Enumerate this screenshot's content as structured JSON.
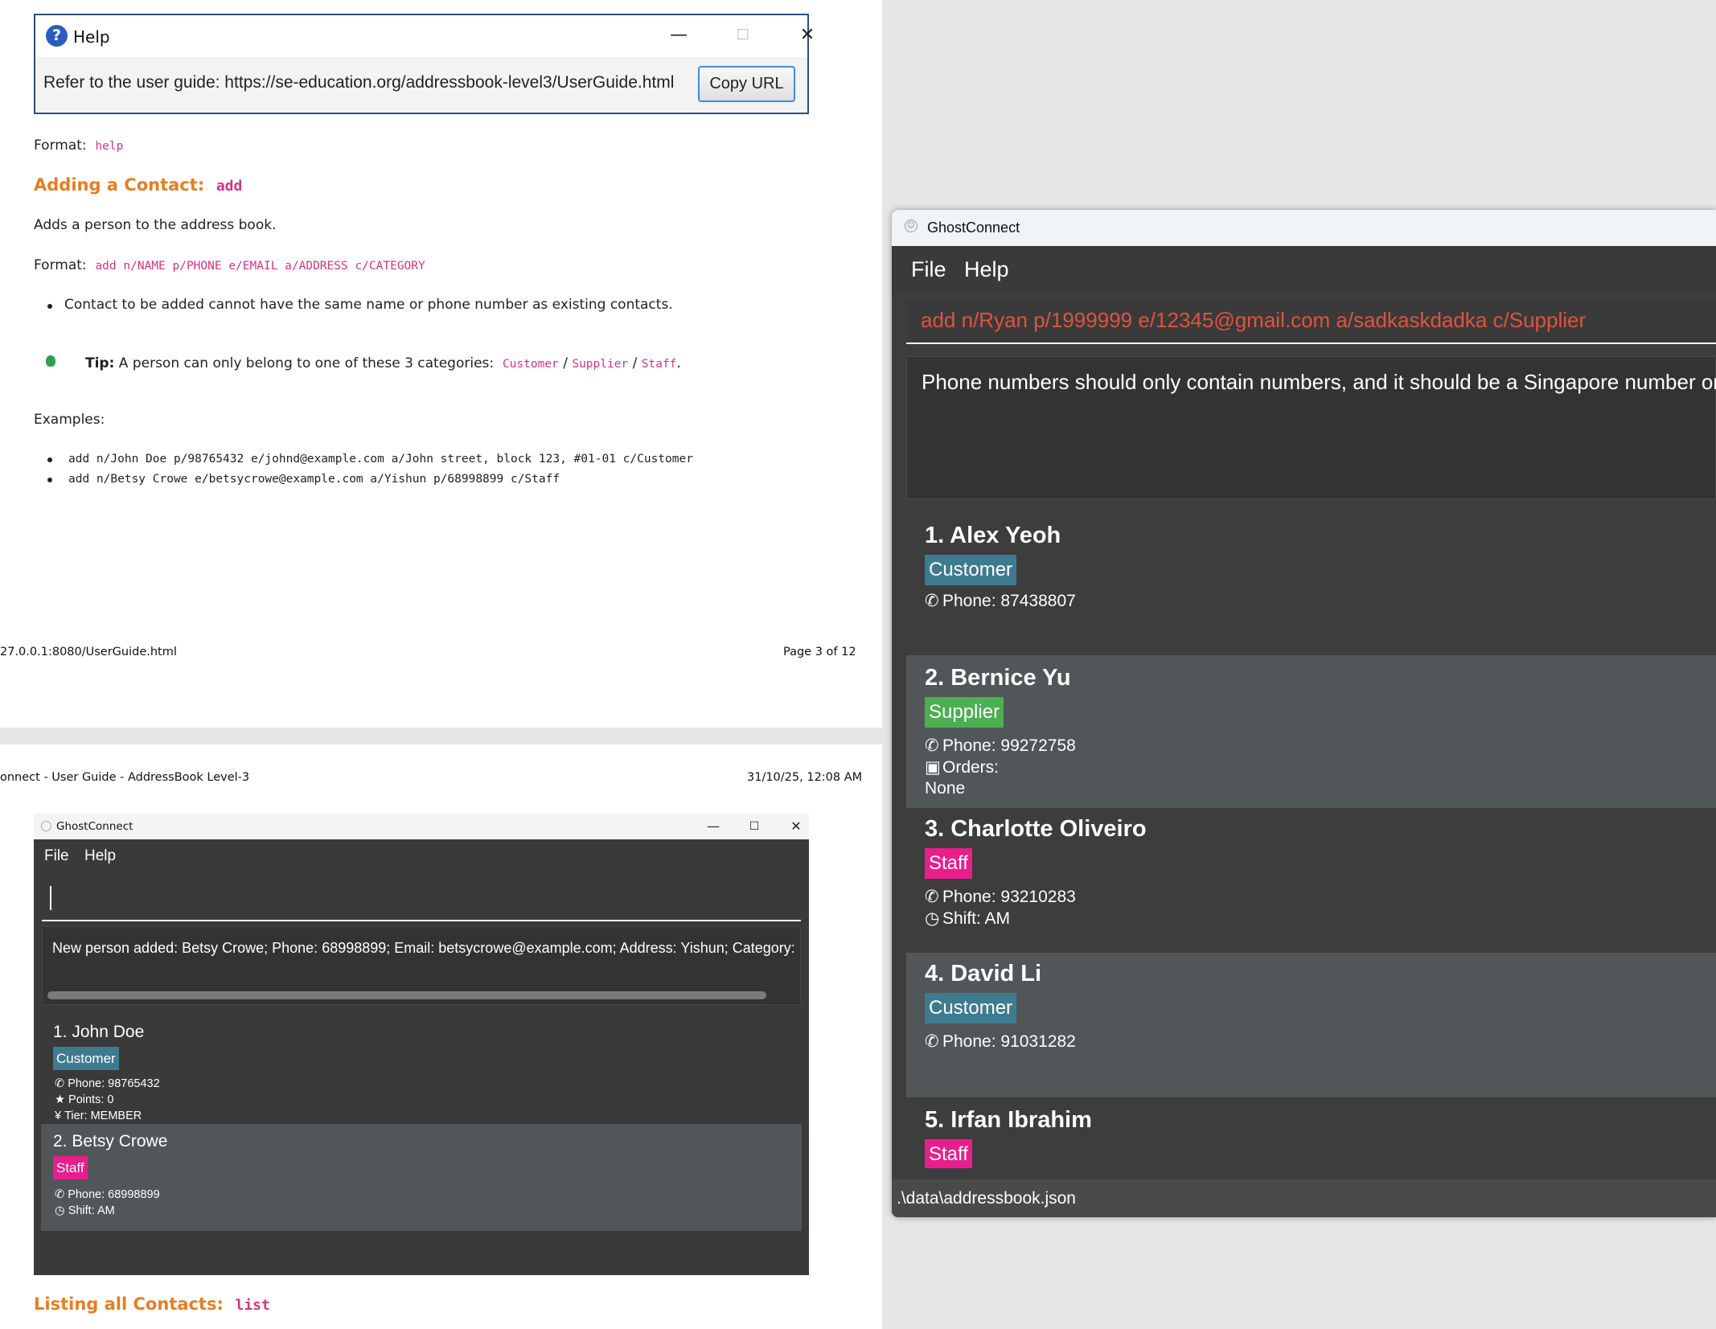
{
  "help_dialog": {
    "title": "Help",
    "icon": "question-icon",
    "message": "Refer to the user guide: https://se-education.org/addressbook-level3/UserGuide.html",
    "copy_button": "Copy URL"
  },
  "page1": {
    "help_format_label": "Format:",
    "help_format_code": "help",
    "add_heading": "Adding a Contact:",
    "add_heading_code": "add",
    "add_desc": "Adds a person to the address book.",
    "add_format_label": "Format:",
    "add_format_code": "add n/NAME p/PHONE e/EMAIL a/ADDRESS c/CATEGORY",
    "bullet_1": "Contact to be added cannot have the same name or phone number as existing contacts.",
    "tip_label": "Tip:",
    "tip_text": "A person can only belong to one of these 3 categories:",
    "tip_cat_1": "Customer",
    "tip_sep_1": "/",
    "tip_cat_2": "Supplier",
    "tip_sep_2": "/",
    "tip_cat_3": "Staff",
    "tip_end": ".",
    "examples_label": "Examples:",
    "example_1": "add n/John Doe p/98765432 e/johnd@example.com a/John street, block 123, #01-01 c/Customer",
    "example_2": "add n/Betsy Crowe e/betsycrowe@example.com a/Yishun p/68998899 c/Staff",
    "footer_url": "27.0.0.1:8080/UserGuide.html",
    "footer_page": "Page 3 of 12"
  },
  "page2": {
    "header_title": "onnect - User Guide - AddressBook Level-3",
    "header_date": "31/10/25, 12:08 AM",
    "list_heading": "Listing all Contacts:",
    "list_heading_code": "list"
  },
  "mini_app": {
    "title": "GhostConnect",
    "menu": [
      "File",
      "Help"
    ],
    "result": "New person added: Betsy Crowe; Phone: 68998899; Email: betsycrowe@example.com; Address: Yishun; Category: [S",
    "persons": [
      {
        "name": "1. John Doe",
        "tag": "Customer",
        "phone": "Phone: 98765432",
        "points": "Points: 0",
        "tier": "Tier: MEMBER"
      },
      {
        "name": "2. Betsy Crowe",
        "tag": "Staff",
        "phone": "Phone: 68998899",
        "shift": "Shift: AM"
      }
    ]
  },
  "app": {
    "title": "GhostConnect",
    "menu": [
      "File",
      "Help"
    ],
    "command_input": "add n/Ryan p/1999999 e/12345@gmail.com a/sadkaskdadka c/Supplier",
    "result": "Phone numbers should only contain numbers, and it should be a Singapore number only.",
    "persons": [
      {
        "name": "1. Alex Yeoh",
        "tag": "Customer",
        "phone": "Phone: 87438807"
      },
      {
        "name": "2. Bernice Yu",
        "tag": "Supplier",
        "phone": "Phone: 99272758",
        "orders_label": "Orders:",
        "orders_value": "None"
      },
      {
        "name": "3. Charlotte Oliveiro",
        "tag": "Staff",
        "phone": "Phone: 93210283",
        "shift": "Shift: AM"
      },
      {
        "name": "4. David Li",
        "tag": "Customer",
        "phone": "Phone: 91031282"
      },
      {
        "name": "5. Irfan Ibrahim",
        "tag": "Staff"
      }
    ],
    "status_path": ".\\data\\addressbook.json"
  },
  "colors": {
    "customer": "#3e7b91",
    "supplier": "#4caf50",
    "staff": "#e91e8c",
    "heading": "#e67e22",
    "code": "#d63384",
    "error_text": "#e0533d"
  }
}
